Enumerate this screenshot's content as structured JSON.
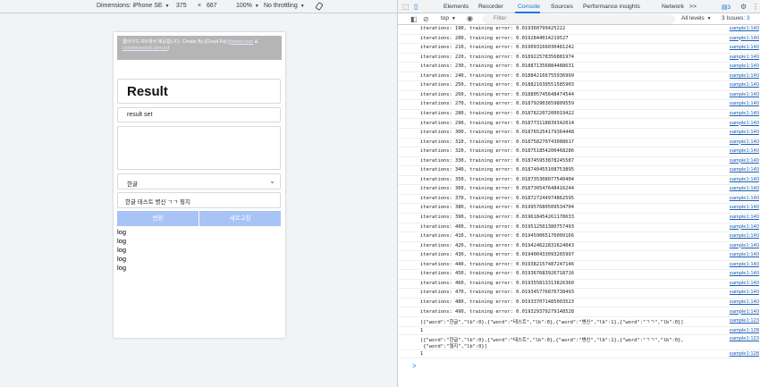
{
  "device_toolbar": {
    "dimensions_label": "Dimensions: iPhone SE",
    "width": "375",
    "times": "×",
    "height": "667",
    "zoom": "100%",
    "throttle": "No throttling"
  },
  "app": {
    "banner_text": "클라우드 RX에서 제공합니다. Create By [Cloud Rx] (",
    "banner_link1": "mainly.com",
    "banner_amp": " &",
    "banner_link2": "cloudresearch.com.kr",
    "banner_close": ")",
    "result_title": "Result",
    "result_set": "result set",
    "textarea_value": "",
    "select_value": "한글",
    "input_value": "한글 테스트 병신 ㄱㄱ 뭥지",
    "convert_button": "변환",
    "refresh_button": "새로고침",
    "logs": [
      "log",
      "log",
      "log",
      "log",
      "log"
    ]
  },
  "devtools": {
    "tabs": [
      "Elements",
      "Recorder",
      "Console",
      "Sources",
      "Performance insights",
      "Network"
    ],
    "active_tab": "Console",
    "more_tabs": ">>",
    "badge_count": "3",
    "context": "top",
    "filter_placeholder": "Filter",
    "levels": "All levels",
    "issues": "3 Issues:",
    "issues_count": "3",
    "console_rows": [
      {
        "msg": "iterations: 190, training error: 0.019360799425222",
        "src": "sample1:140"
      },
      {
        "msg": "iterations: 200, training error: 0.0192844014219527",
        "src": "sample1:140"
      },
      {
        "msg": "iterations: 210, training error: 0.019093166030481242",
        "src": "sample1:140"
      },
      {
        "msg": "iterations: 220, training error: 0.018922578356881974",
        "src": "sample1:140"
      },
      {
        "msg": "iterations: 230, training error: 0.018871356884488631",
        "src": "sample1:140"
      },
      {
        "msg": "iterations: 240, training error: 0.018842166755936999",
        "src": "sample1:140"
      },
      {
        "msg": "iterations: 250, training error: 0.018821630551585903",
        "src": "sample1:140"
      },
      {
        "msg": "iterations: 260, training error: 0.018805745648474544",
        "src": "sample1:140"
      },
      {
        "msg": "iterations: 270, training error: 0.018792903659809559",
        "src": "sample1:140"
      },
      {
        "msg": "iterations: 280, training error: 0.018782207200019422",
        "src": "sample1:140"
      },
      {
        "msg": "iterations: 290, training error: 0.018773118839342014",
        "src": "sample1:140"
      },
      {
        "msg": "iterations: 300, training error: 0.018765254179364448",
        "src": "sample1:140"
      },
      {
        "msg": "iterations: 310, training error: 0.018758270743088617",
        "src": "sample1:140"
      },
      {
        "msg": "iterations: 320, training error: 0.018751854200468286",
        "src": "sample1:140"
      },
      {
        "msg": "iterations: 330, training error: 0.018745953878245587",
        "src": "sample1:140"
      },
      {
        "msg": "iterations: 340, training error: 0.018740455108753895",
        "src": "sample1:140"
      },
      {
        "msg": "iterations: 350, training error: 0.018735308077540404",
        "src": "sample1:140"
      },
      {
        "msg": "iterations: 360, training error: 0.018730547648416244",
        "src": "sample1:140"
      },
      {
        "msg": "iterations: 370, training error: 0.018727244974862595",
        "src": "sample1:140"
      },
      {
        "msg": "iterations: 380, training error: 0.019957680509534704",
        "src": "sample1:140"
      },
      {
        "msg": "iterations: 390, training error: 0.019618454261178633",
        "src": "sample1:140"
      },
      {
        "msg": "iterations: 400, training error: 0.019512501380757493",
        "src": "sample1:140"
      },
      {
        "msg": "iterations: 410, training error: 0.019459065176009166",
        "src": "sample1:140"
      },
      {
        "msg": "iterations: 420, training error: 0.019424622831624043",
        "src": "sample1:140"
      },
      {
        "msg": "iterations: 430, training error: 0.019400433093265997",
        "src": "sample1:140"
      },
      {
        "msg": "iterations: 440, training error: 0.019382157487247146",
        "src": "sample1:140"
      },
      {
        "msg": "iterations: 450, training error: 0.019367683926718716",
        "src": "sample1:140"
      },
      {
        "msg": "iterations: 460, training error: 0.019355813313826360",
        "src": "sample1:140"
      },
      {
        "msg": "iterations: 470, training error: 0.019345776876738493",
        "src": "sample1:140"
      },
      {
        "msg": "iterations: 480, training error: 0.019337071485003523",
        "src": "sample1:140"
      },
      {
        "msg": "iterations: 490, training error: 0.019329379279148528",
        "src": "sample1:140"
      }
    ],
    "array_summary": "[{\"word\":\"한글\",\"lb\":0},{\"word\":\"테스트\",\"lb\":0},{\"word\":\"병신\",\"lb\":1},{\"word\":\"ㄱㄱ\",\"lb\":0}]",
    "array_src": "sample1:123",
    "one_a": "1",
    "one_a_src": "sample1:128",
    "array_full_1": "[{\"word\":\"한글\",\"lb\":0},{\"word\":\"테스트\",\"lb\":0},{\"word\":\"병신\",\"lb\":1},{\"word\":\"ㄱㄱ\",\"lb\":0},",
    "array_full_2": " {\"word\":\"뭥지\",\"lb\":0}]",
    "array_full_src": "sample1:123",
    "one_b": "1",
    "one_b_src": "sample1:128",
    "prompt": ">"
  }
}
